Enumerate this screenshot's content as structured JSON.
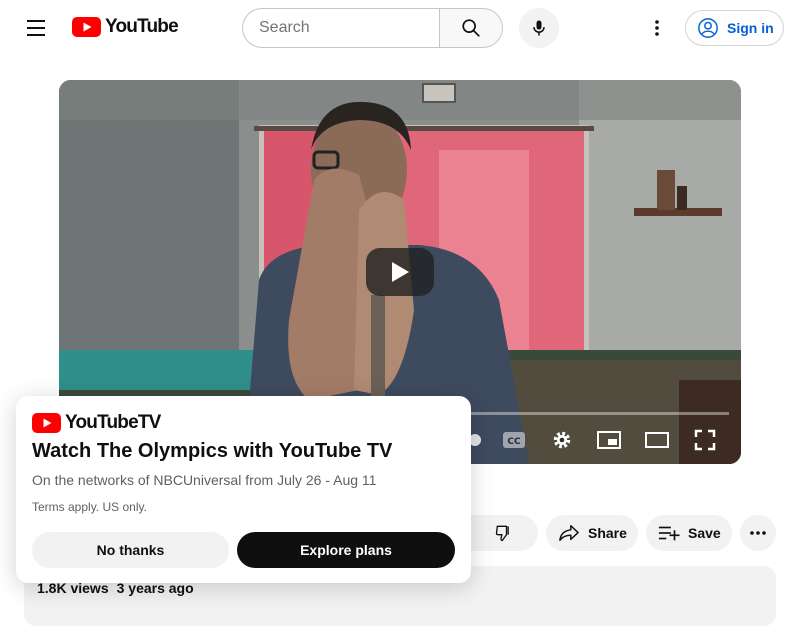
{
  "header": {
    "logo_text": "YouTube",
    "search_placeholder": "Search",
    "signin_label": "Sign in"
  },
  "colors": {
    "brand_red": "#ff0000",
    "accent_blue": "#065fd4",
    "chip_bg": "#f2f2f2"
  },
  "icons": {
    "menu": "hamburger-icon",
    "search": "search-icon",
    "mic": "mic-icon",
    "more": "more-vert-icon",
    "account": "account-circle-icon",
    "play": "play-icon",
    "settings": "gear-icon",
    "miniplayer": "miniplayer-icon",
    "theater": "theater-icon",
    "fullscreen": "fullscreen-icon",
    "dislike": "thumb-down-icon",
    "share": "share-icon",
    "save": "playlist-add-icon",
    "more_actions": "more-horiz-icon"
  },
  "actions": {
    "share_label": "Share",
    "save_label": "Save"
  },
  "description": {
    "views": "1.8K views",
    "age": "3 years ago"
  },
  "promo": {
    "logo_text": "YouTube",
    "logo_suffix": "TV",
    "title": "Watch The Olympics with YouTube TV",
    "subtitle": "On the networks of NBCUniversal from July 26 - Aug 11",
    "terms": "Terms apply. US only.",
    "no_thanks_label": "No thanks",
    "explore_label": "Explore plans"
  }
}
